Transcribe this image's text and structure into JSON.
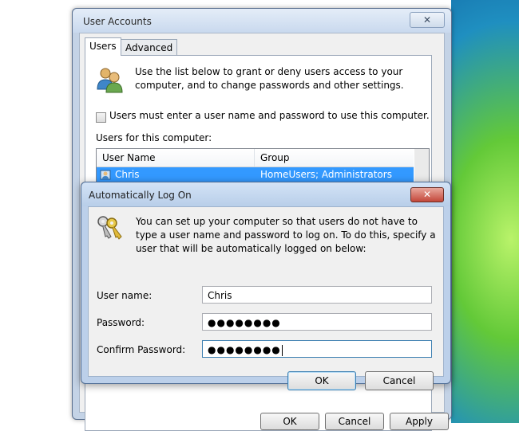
{
  "user_accounts": {
    "title": "User Accounts",
    "close_symbol": "✕",
    "tabs": [
      {
        "label": "Users",
        "active": true
      },
      {
        "label": "Advanced",
        "active": false
      }
    ],
    "intro": "Use the list below to grant or deny users access to your computer, and to change passwords and other settings.",
    "checkbox_label": "Users must enter a user name and password to use this computer.",
    "checkbox_checked": false,
    "list_label": "Users for this computer:",
    "columns": [
      "User Name",
      "Group"
    ],
    "rows": [
      {
        "user": "Chris",
        "group": "HomeUsers; Administrators",
        "selected": true
      }
    ],
    "buttons": {
      "ok": "OK",
      "cancel": "Cancel",
      "apply": "Apply"
    }
  },
  "auto_logon": {
    "title": "Automatically Log On",
    "close_symbol": "✕",
    "description": "You can set up your computer so that users do not have to type a user name and password to log on. To do this, specify a user that will be automatically logged on below:",
    "fields": {
      "username_label": "User name:",
      "username_value": "Chris",
      "password_label": "Password:",
      "password_value": "●●●●●●●●",
      "confirm_label": "Confirm Password:",
      "confirm_value": "●●●●●●●●"
    },
    "buttons": {
      "ok": "OK",
      "cancel": "Cancel"
    }
  },
  "icons": {
    "users": "users-icon",
    "keys": "keys-icon",
    "user_row": "user-icon"
  },
  "colors": {
    "selection": "#3399ff",
    "accent_focus": "#3c7fb1",
    "close_red": "#c3473a"
  }
}
